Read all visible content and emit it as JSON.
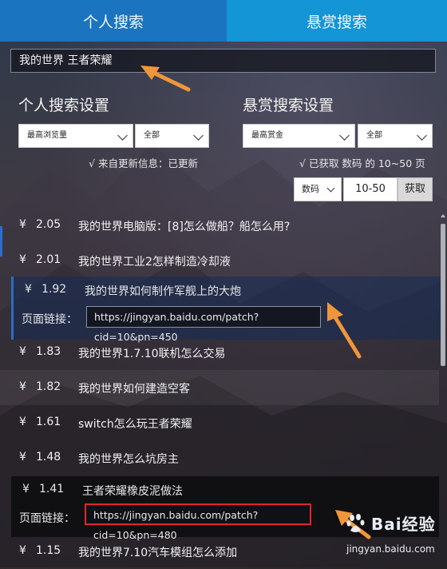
{
  "tabs": [
    {
      "label": "个人搜索"
    },
    {
      "label": "悬赏搜索"
    }
  ],
  "search": {
    "value": "我的世界 王者荣耀"
  },
  "personal_settings": {
    "title": "个人搜索设置",
    "sort_select": "最高浏览量",
    "scope_select": "全部",
    "info": "√ 来自更新信息：已更新"
  },
  "reward_settings": {
    "title": "悬赏搜索设置",
    "sort_select": "最高赏金",
    "scope_select": "全部",
    "info": "√ 已获取 数码 的 10~50 页",
    "category_select": "数码",
    "range_value": "10-50",
    "fetch_label": "获取"
  },
  "results": [
    {
      "currency": "¥",
      "amount": "2.05",
      "title": "我的世界电脑版：[8]怎么做船？船怎么用?"
    },
    {
      "currency": "¥",
      "amount": "2.01",
      "title": "我的世界工业2怎样制造冷却液"
    },
    {
      "currency": "¥",
      "amount": "1.92",
      "title": "我的世界如何制作军舰上的大炮",
      "link_label": "页面链接：",
      "link": "https://jingyan.baidu.com/patch?cid=10&pn=450"
    },
    {
      "currency": "¥",
      "amount": "1.83",
      "title": "我的世界1.7.10联机怎么交易"
    },
    {
      "currency": "¥",
      "amount": "1.82",
      "title": "我的世界如何建造空客"
    },
    {
      "currency": "¥",
      "amount": "1.61",
      "title": "switch怎么玩王者荣耀"
    },
    {
      "currency": "¥",
      "amount": "1.48",
      "title": "我的世界怎么坑房主"
    },
    {
      "currency": "¥",
      "amount": "1.41",
      "title": "王者荣耀橡皮泥做法",
      "link_label": "页面链接：",
      "link": "https://jingyan.baidu.com/patch?cid=10&pn=480"
    },
    {
      "currency": "¥",
      "amount": "1.15",
      "title": "我的世界7.10汽车模组怎么添加"
    }
  ],
  "watermark": {
    "brand": "Bai经验",
    "url": "jingyan.baidu.com"
  },
  "colors": {
    "tab_active": "#1a74bf",
    "tab_inactive": "#1395d6",
    "arrow": "#f0963a",
    "highlight_box": "#e0262c"
  }
}
